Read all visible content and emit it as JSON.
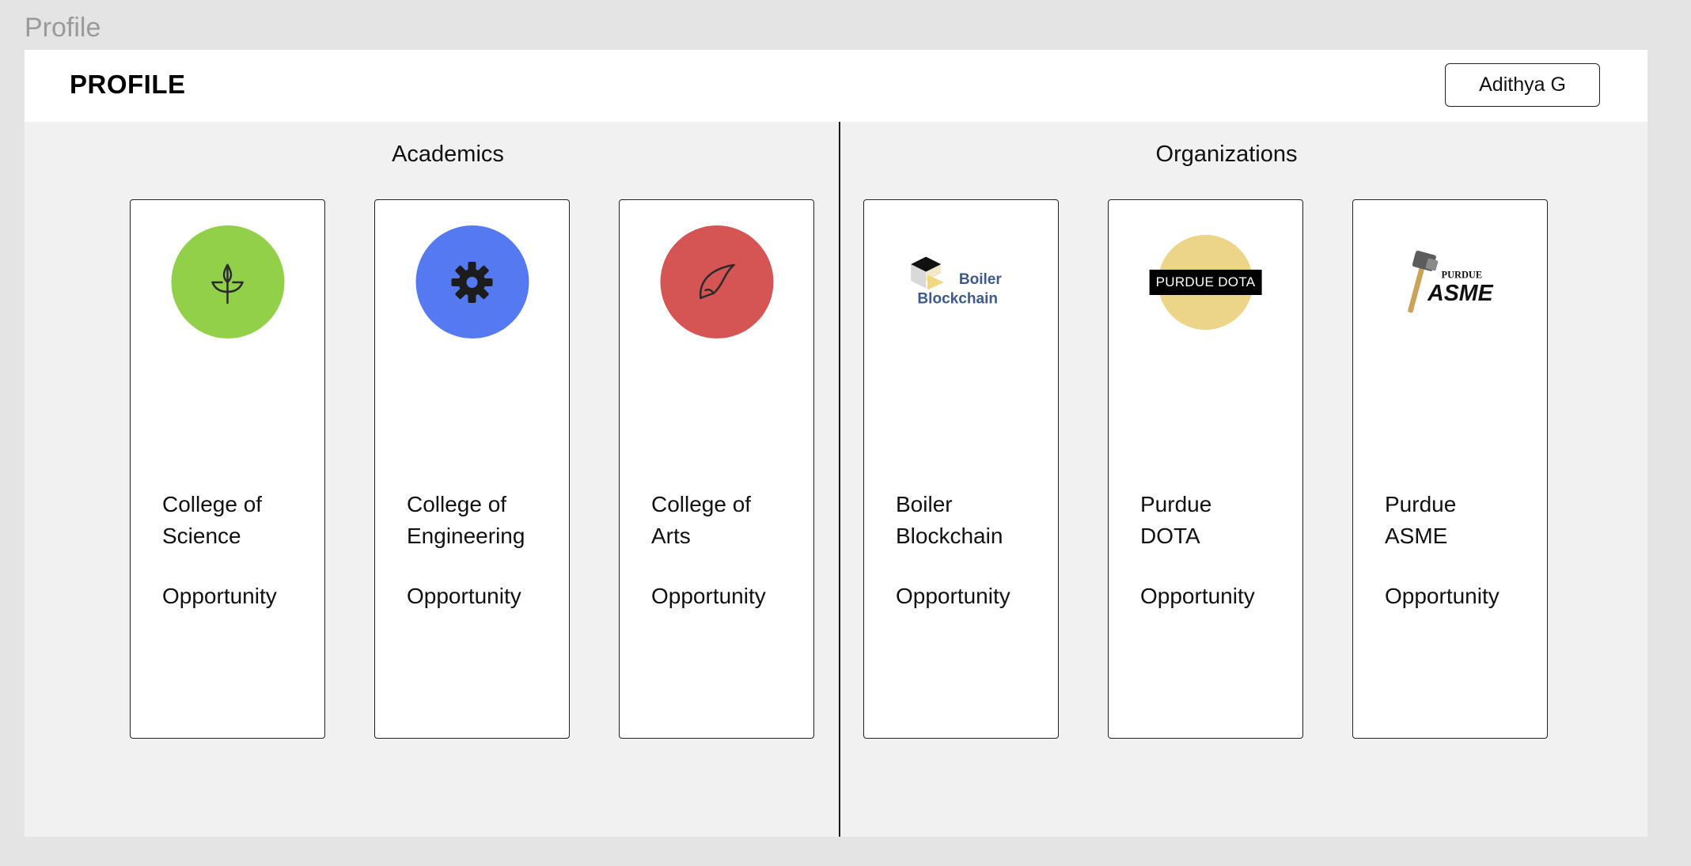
{
  "frame_label": "Profile",
  "header": {
    "title": "PROFILE",
    "user_button": "Adithya G"
  },
  "sections": {
    "academics": "Academics",
    "organizations": "Organizations"
  },
  "cards": [
    {
      "name": "College of\nScience",
      "opportunity": "Opportunity",
      "logo": "plant-icon",
      "color": "#92d04a"
    },
    {
      "name": "College of\nEngineering",
      "opportunity": "Opportunity",
      "logo": "gear-icon",
      "color": "#5479f0"
    },
    {
      "name": "College of\nArts",
      "opportunity": "Opportunity",
      "logo": "feather-icon",
      "color": "#d55554"
    },
    {
      "name": "Boiler\nBlockchain",
      "opportunity": "Opportunity",
      "logo": "boiler-blockchain-logo",
      "logo_text": [
        "Boiler",
        "Blockchain"
      ]
    },
    {
      "name": "Purdue\nDOTA",
      "opportunity": "Opportunity",
      "logo": "purdue-dota-logo",
      "logo_text": "PURDUE DOTA",
      "color": "#ecd488"
    },
    {
      "name": "Purdue\nASME",
      "opportunity": "Opportunity",
      "logo": "purdue-asme-logo",
      "logo_text": [
        "PURDUE",
        "ASME"
      ]
    }
  ]
}
